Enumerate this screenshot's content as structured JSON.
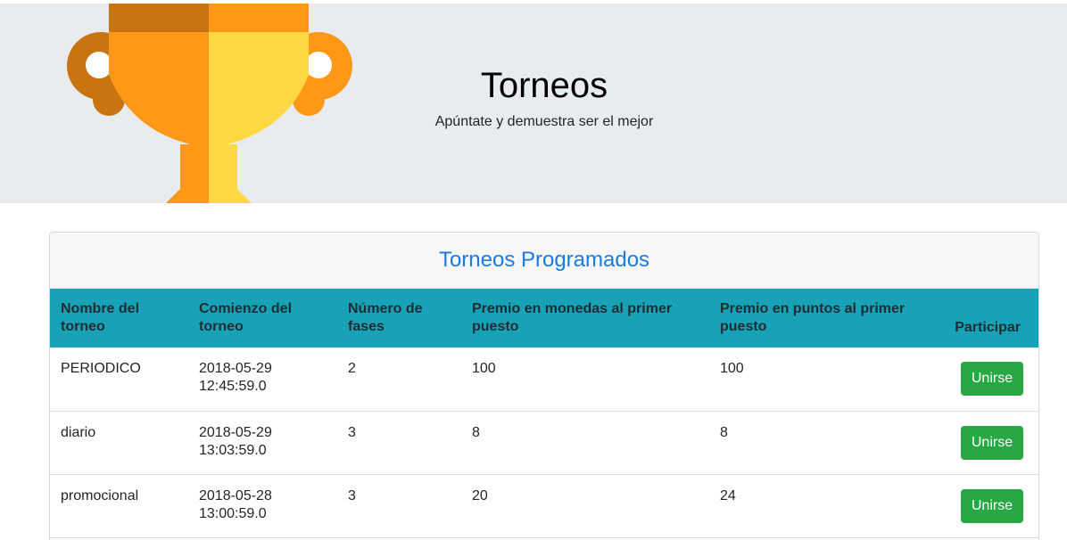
{
  "hero": {
    "title": "Torneos",
    "subtitle": "Apúntate y demuestra ser el mejor",
    "icon": "trophy-icon"
  },
  "card": {
    "title": "Torneos Programados",
    "columns": [
      "Nombre del torneo",
      "Comienzo del torneo",
      "Número de fases",
      "Premio en monedas al primer puesto",
      "Premio en puntos al primer puesto",
      "Participar"
    ],
    "rows": [
      {
        "name": "PERIODICO",
        "date": "2018-05-29",
        "time": "12:45:59.0",
        "phases": "2",
        "coins": "100",
        "points": "100",
        "action": "Unirse"
      },
      {
        "name": "diario",
        "date": "2018-05-29",
        "time": "13:03:59.0",
        "phases": "3",
        "coins": "8",
        "points": "8",
        "action": "Unirse"
      },
      {
        "name": "promocional",
        "date": "2018-05-28",
        "time": "13:00:59.0",
        "phases": "3",
        "coins": "20",
        "points": "24",
        "action": "Unirse"
      }
    ]
  },
  "colors": {
    "header_bg": "#e9ecef",
    "table_head": "#17a2b8",
    "card_title": "#1a7be6",
    "button": "#28a745"
  }
}
